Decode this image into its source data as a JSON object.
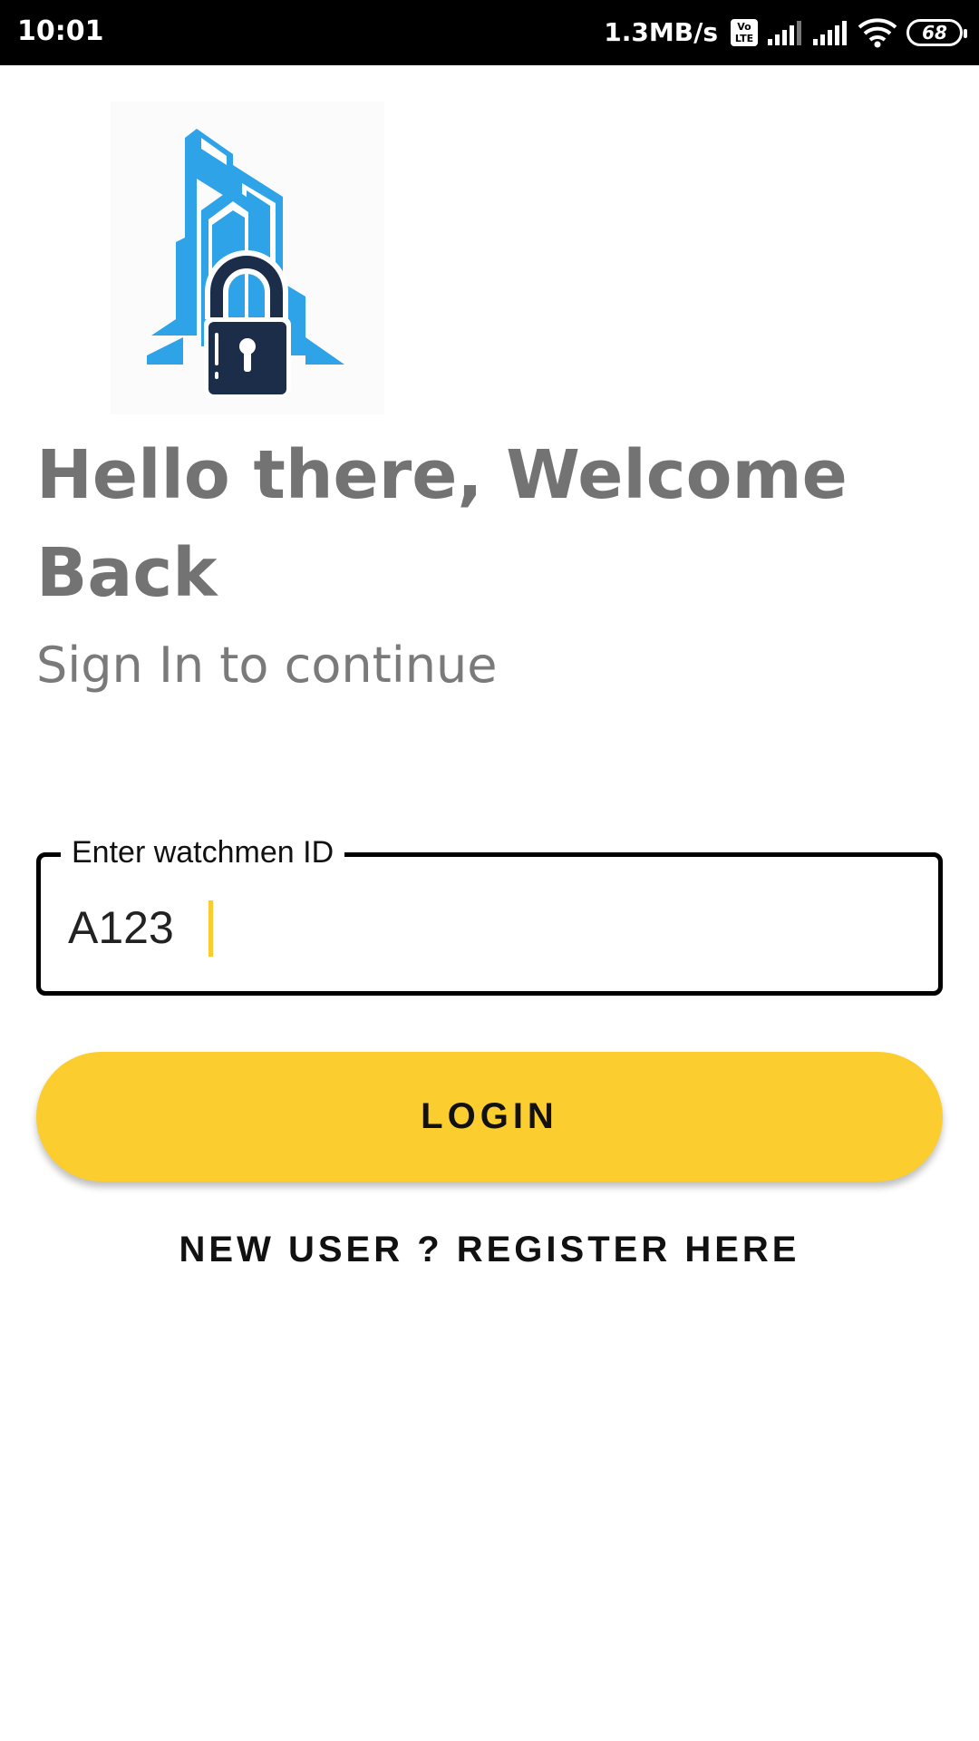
{
  "status_bar": {
    "time": "10:01",
    "net_speed": "1.3MB/s",
    "volte_line1": "Vo",
    "volte_line2": "LTE",
    "battery_level": "68"
  },
  "login": {
    "title": "Hello there, Welcome Back",
    "subtitle": "Sign In to continue",
    "field_label": "Enter watchmen ID",
    "field_value": "A123",
    "login_label": "LOGIN",
    "register_label": "NEW USER ? REGISTER HERE"
  },
  "colors": {
    "accent": "#fbcd2f",
    "logo_blue": "#2ea3e8",
    "logo_navy": "#1b2d48",
    "heading_gray": "#737373"
  }
}
